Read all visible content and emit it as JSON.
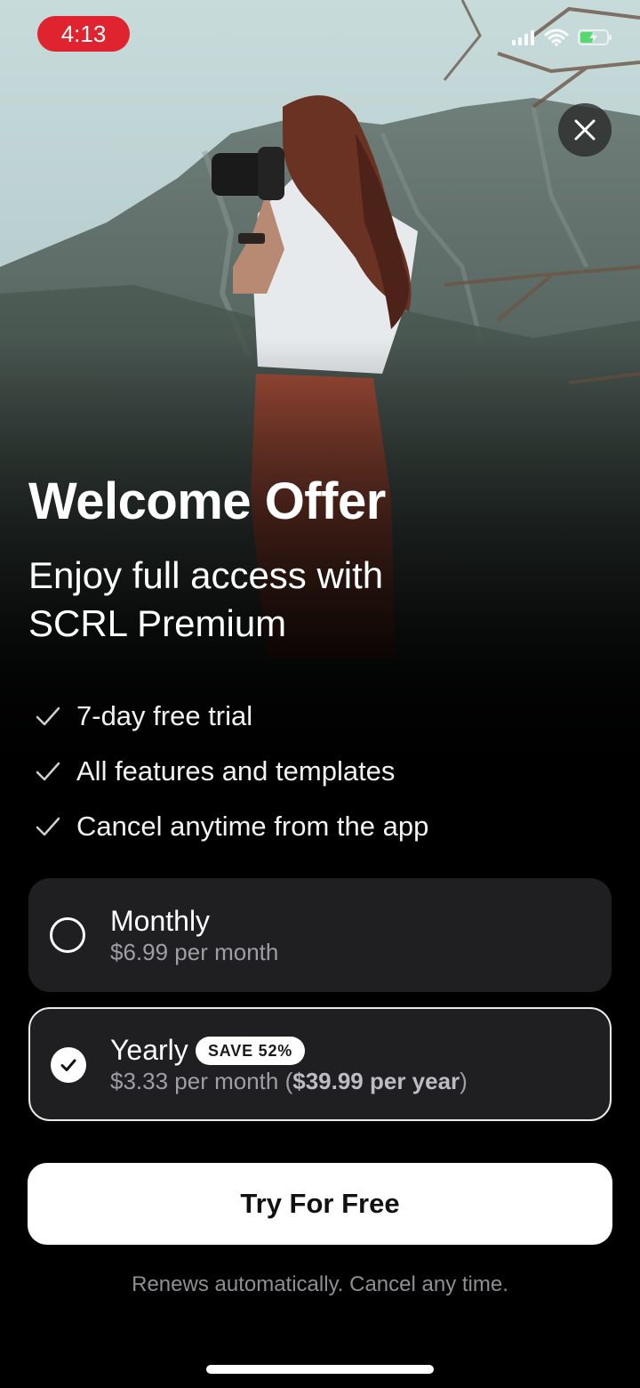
{
  "status_bar": {
    "time": "4:13",
    "time_pill_color": "#e0242f",
    "icons": [
      "cellular-signal-icon",
      "wifi-icon",
      "battery-charging-icon"
    ]
  },
  "close_icon": "close-icon",
  "offer": {
    "title": "Welcome Offer",
    "subtitle": "Enjoy full access with SCRL Premium"
  },
  "features": [
    {
      "icon": "checkmark-icon",
      "label": "7-day free trial"
    },
    {
      "icon": "checkmark-icon",
      "label": "All features and templates"
    },
    {
      "icon": "checkmark-icon",
      "label": "Cancel anytime from the app"
    }
  ],
  "plans": {
    "monthly": {
      "name": "Monthly",
      "price": "$6.99 per month",
      "selected": false
    },
    "yearly": {
      "name": "Yearly",
      "badge": "SAVE 52%",
      "price_prefix": "$3.33 per month (",
      "price_bold": "$39.99 per year",
      "price_suffix": ")",
      "selected": true
    }
  },
  "cta": {
    "label": "Try For Free"
  },
  "footer": {
    "renew_note": "Renews automatically. Cancel any time."
  },
  "colors": {
    "background": "#000000",
    "card": "#1f1e21",
    "accent_text": "#ffffff",
    "muted_text": "#9e9ea3"
  }
}
